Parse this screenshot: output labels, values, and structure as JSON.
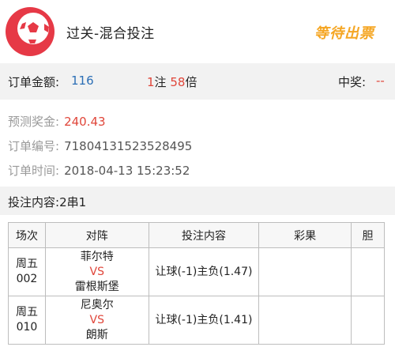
{
  "header": {
    "title": "过关-混合投注",
    "status_stamp": "等待出票"
  },
  "order": {
    "amount_label": "订单金额:",
    "amount_value": "116",
    "bets_count": "1",
    "bets_unit": "注",
    "multiplier": "58",
    "multiplier_unit": "倍",
    "prize_label": "中奖:",
    "prize_value": "--"
  },
  "details": {
    "predicted_label": "预测奖金:",
    "predicted_value": "240.43",
    "order_no_label": "订单编号:",
    "order_no_value": "71804131523528495",
    "order_time_label": "订单时间:",
    "order_time_value": "2018-04-13 15:23:52"
  },
  "bet": {
    "label": "投注内容:",
    "value": "2串1"
  },
  "table": {
    "headers": [
      "场次",
      "对阵",
      "投注内容",
      "彩果",
      "胆"
    ],
    "rows": [
      {
        "day": "周五",
        "num": "002",
        "home": "菲尔特",
        "vs": "VS",
        "away": "雷根斯堡",
        "bet": "让球(-1)主负(1.47)",
        "result": "",
        "banker": ""
      },
      {
        "day": "周五",
        "num": "010",
        "home": "尼奥尔",
        "vs": "VS",
        "away": "朗斯",
        "bet": "让球(-1)主负(1.41)",
        "result": "",
        "banker": ""
      }
    ]
  },
  "colors": {
    "accent_red": "#e0463a",
    "amount_blue": "#2c6fb6",
    "stamp_orange": "#f5a623",
    "bar_gray": "#f2f2f2"
  },
  "icons": {
    "logo": "soccer-ball-icon"
  }
}
